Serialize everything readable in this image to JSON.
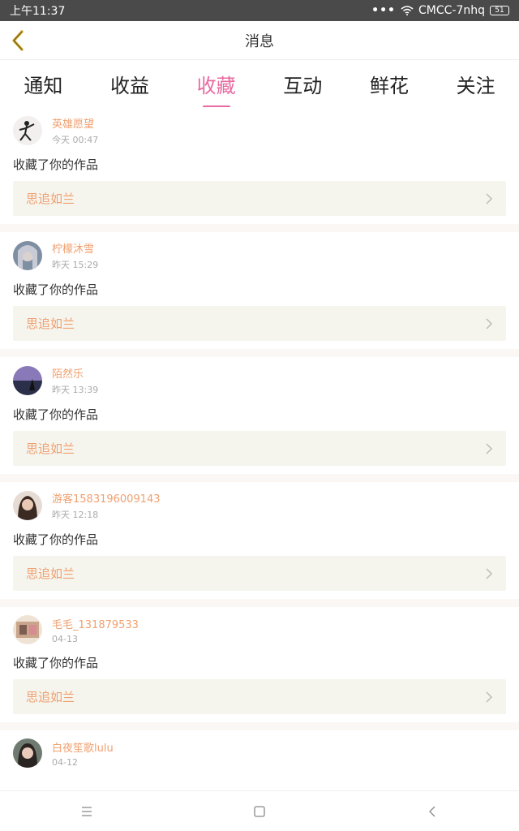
{
  "status_bar": {
    "time": "上午11:37",
    "carrier": "CMCC-7nhq",
    "battery": "51"
  },
  "header": {
    "title": "消息"
  },
  "tabs": [
    {
      "label": "通知"
    },
    {
      "label": "收益"
    },
    {
      "label": "收藏",
      "active": true
    },
    {
      "label": "互动"
    },
    {
      "label": "鲜花"
    },
    {
      "label": "关注"
    }
  ],
  "messages": [
    {
      "user": "英雄愿望",
      "time": "今天 00:47",
      "text": "收藏了你的作品",
      "work": "思追如兰"
    },
    {
      "user": "柠檬沐雪",
      "time": "昨天 15:29",
      "text": "收藏了你的作品",
      "work": "思追如兰"
    },
    {
      "user": "陌然乐",
      "time": "昨天 13:39",
      "text": "收藏了你的作品",
      "work": "思追如兰"
    },
    {
      "user": "游客1583196009143",
      "time": "昨天 12:18",
      "text": "收藏了你的作品",
      "work": "思追如兰"
    },
    {
      "user": "毛毛_131879533",
      "time": "04-13",
      "text": "收藏了你的作品",
      "work": "思追如兰"
    },
    {
      "user": "白夜笙歌lulu",
      "time": "04-12",
      "text": "",
      "work": ""
    }
  ],
  "colors": {
    "accent": "#e76aa0",
    "username": "#f0a070",
    "card_bg": "#f5f5ee"
  }
}
